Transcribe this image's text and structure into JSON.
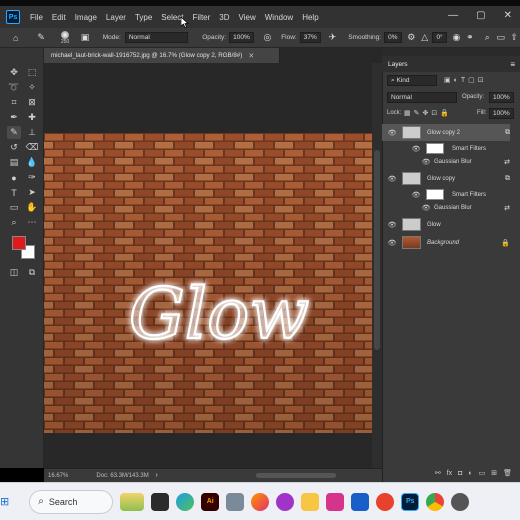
{
  "app": {
    "logo": "Ps",
    "menu": [
      "File",
      "Edit",
      "Image",
      "Layer",
      "Type",
      "Select",
      "Filter",
      "3D",
      "View",
      "Window",
      "Help"
    ],
    "window_controls": [
      "—",
      "▢",
      "✕"
    ]
  },
  "options_bar": {
    "brush_size": "250",
    "mode_label": "Mode:",
    "mode_value": "Normal",
    "opacity_label": "Opacity:",
    "opacity_value": "100%",
    "flow_label": "Flow:",
    "flow_value": "37%",
    "smoothing_label": "Smoothing:",
    "smoothing_value": "0%",
    "angle_value": "0°"
  },
  "document": {
    "tab_title": "michael_laut-brick-wall-1916752.jpg @ 16.7% (Glow copy 2, RGB/8#)",
    "tab_close": "✕",
    "canvas_text": "Glow",
    "zoom": "16.67%",
    "doc_size": "Doc: 63.3M/143.3M"
  },
  "colors": {
    "foreground": "#e01a1a",
    "background": "#ffffff",
    "ps_blue": "#31a8ff"
  },
  "layers_panel": {
    "title": "Layers",
    "filter_kind": "Kind",
    "blend_mode": "Normal",
    "opacity_label": "Opacity:",
    "opacity_value": "100%",
    "lock_label": "Lock:",
    "fill_label": "Fill:",
    "fill_value": "100%",
    "layers": [
      {
        "name": "Glow copy 2",
        "selected": true
      },
      {
        "name": "Smart Filters",
        "sub": true
      },
      {
        "name": "Gaussian Blur",
        "subfilter": true
      },
      {
        "name": "Glow copy",
        "selected": false
      },
      {
        "name": "Smart Filters",
        "sub": true
      },
      {
        "name": "Gaussian Blur",
        "subfilter": true
      },
      {
        "name": "Glow",
        "selected": false
      },
      {
        "name": "Background",
        "italic": true
      }
    ]
  },
  "taskbar": {
    "search_label": "Search",
    "apps": [
      "Ai",
      "Ps"
    ]
  }
}
